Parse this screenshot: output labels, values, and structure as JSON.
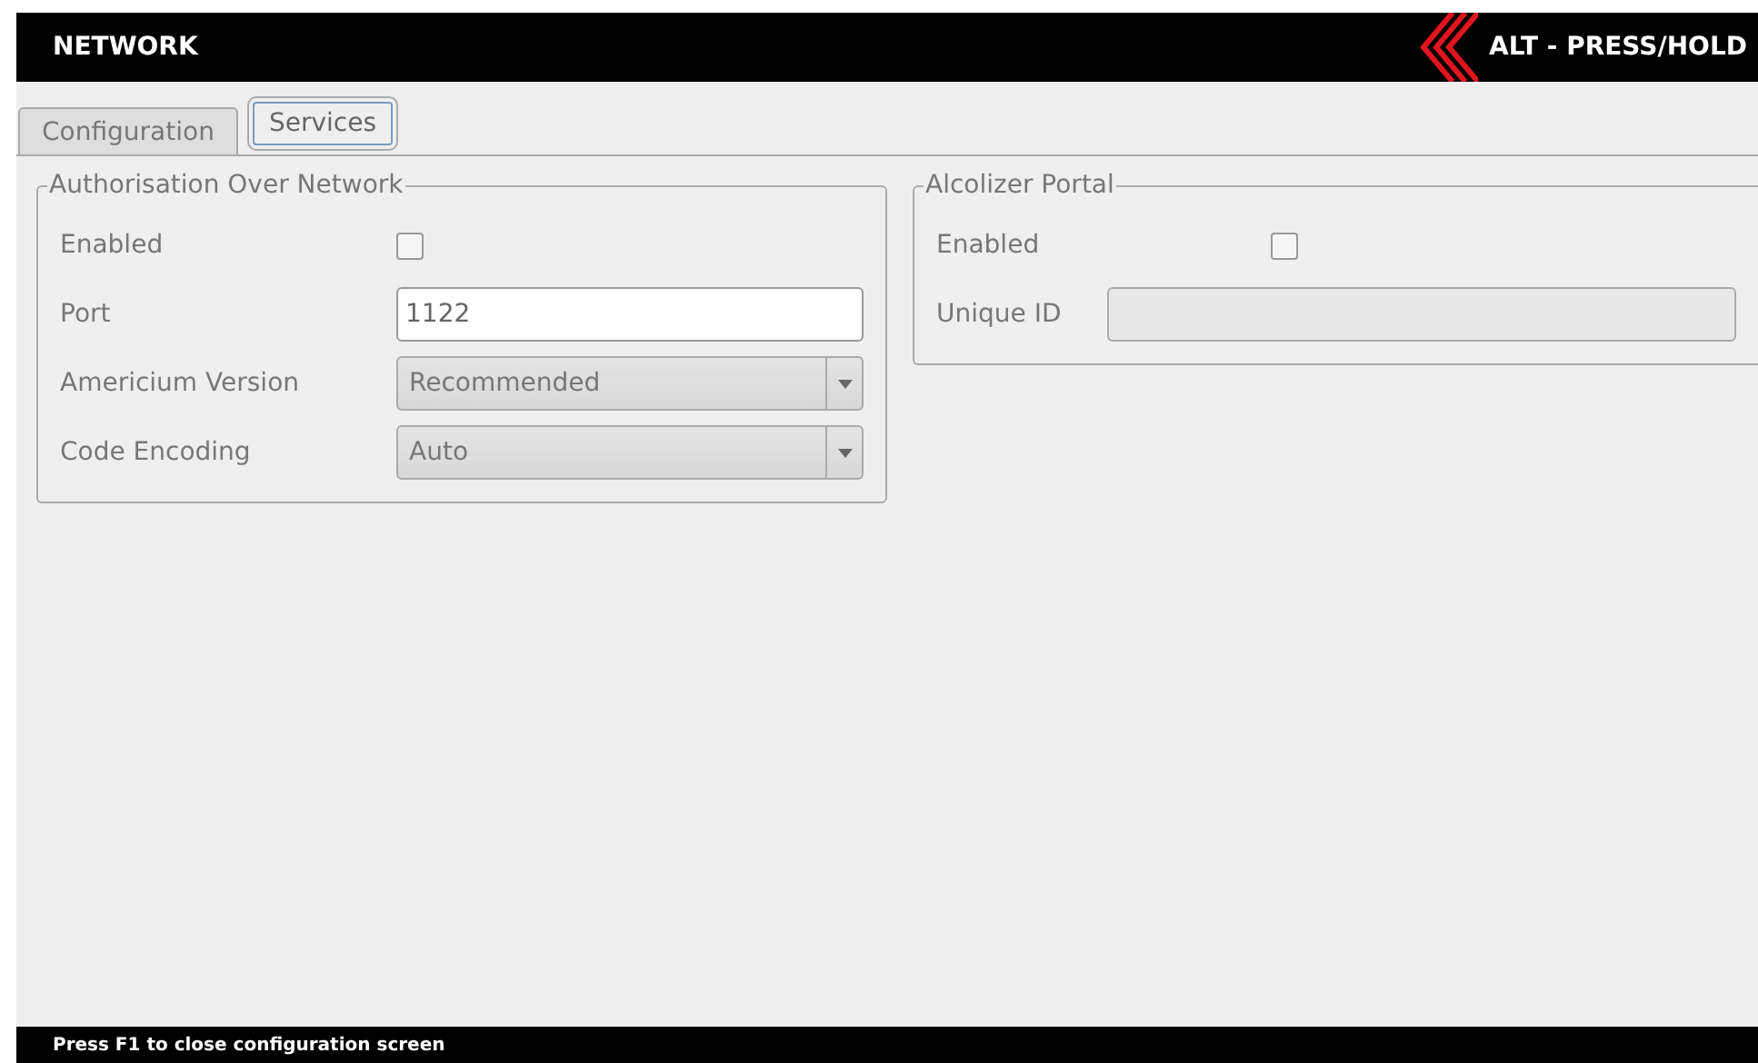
{
  "header": {
    "title": "NETWORK",
    "hint": "ALT - PRESS/HOLD"
  },
  "tabs": [
    {
      "label": "Configuration",
      "selected": false
    },
    {
      "label": "Services",
      "selected": true
    }
  ],
  "groups": [
    {
      "title": "Authorisation Over Network",
      "fields": [
        {
          "kind": "checkbox",
          "label": "Enabled",
          "checked": false
        },
        {
          "kind": "text",
          "label": "Port",
          "value": "1122",
          "disabled": false
        },
        {
          "kind": "select",
          "label": "Americium Version",
          "value": "Recommended"
        },
        {
          "kind": "select",
          "label": "Code Encoding",
          "value": "Auto"
        }
      ]
    },
    {
      "title": "Alcolizer Portal",
      "fields": [
        {
          "kind": "checkbox",
          "label": "Enabled",
          "checked": false
        },
        {
          "kind": "text",
          "label": "Unique ID",
          "disabled": true
        }
      ]
    }
  ],
  "status_bar": "Press F1 to close configuration screen"
}
